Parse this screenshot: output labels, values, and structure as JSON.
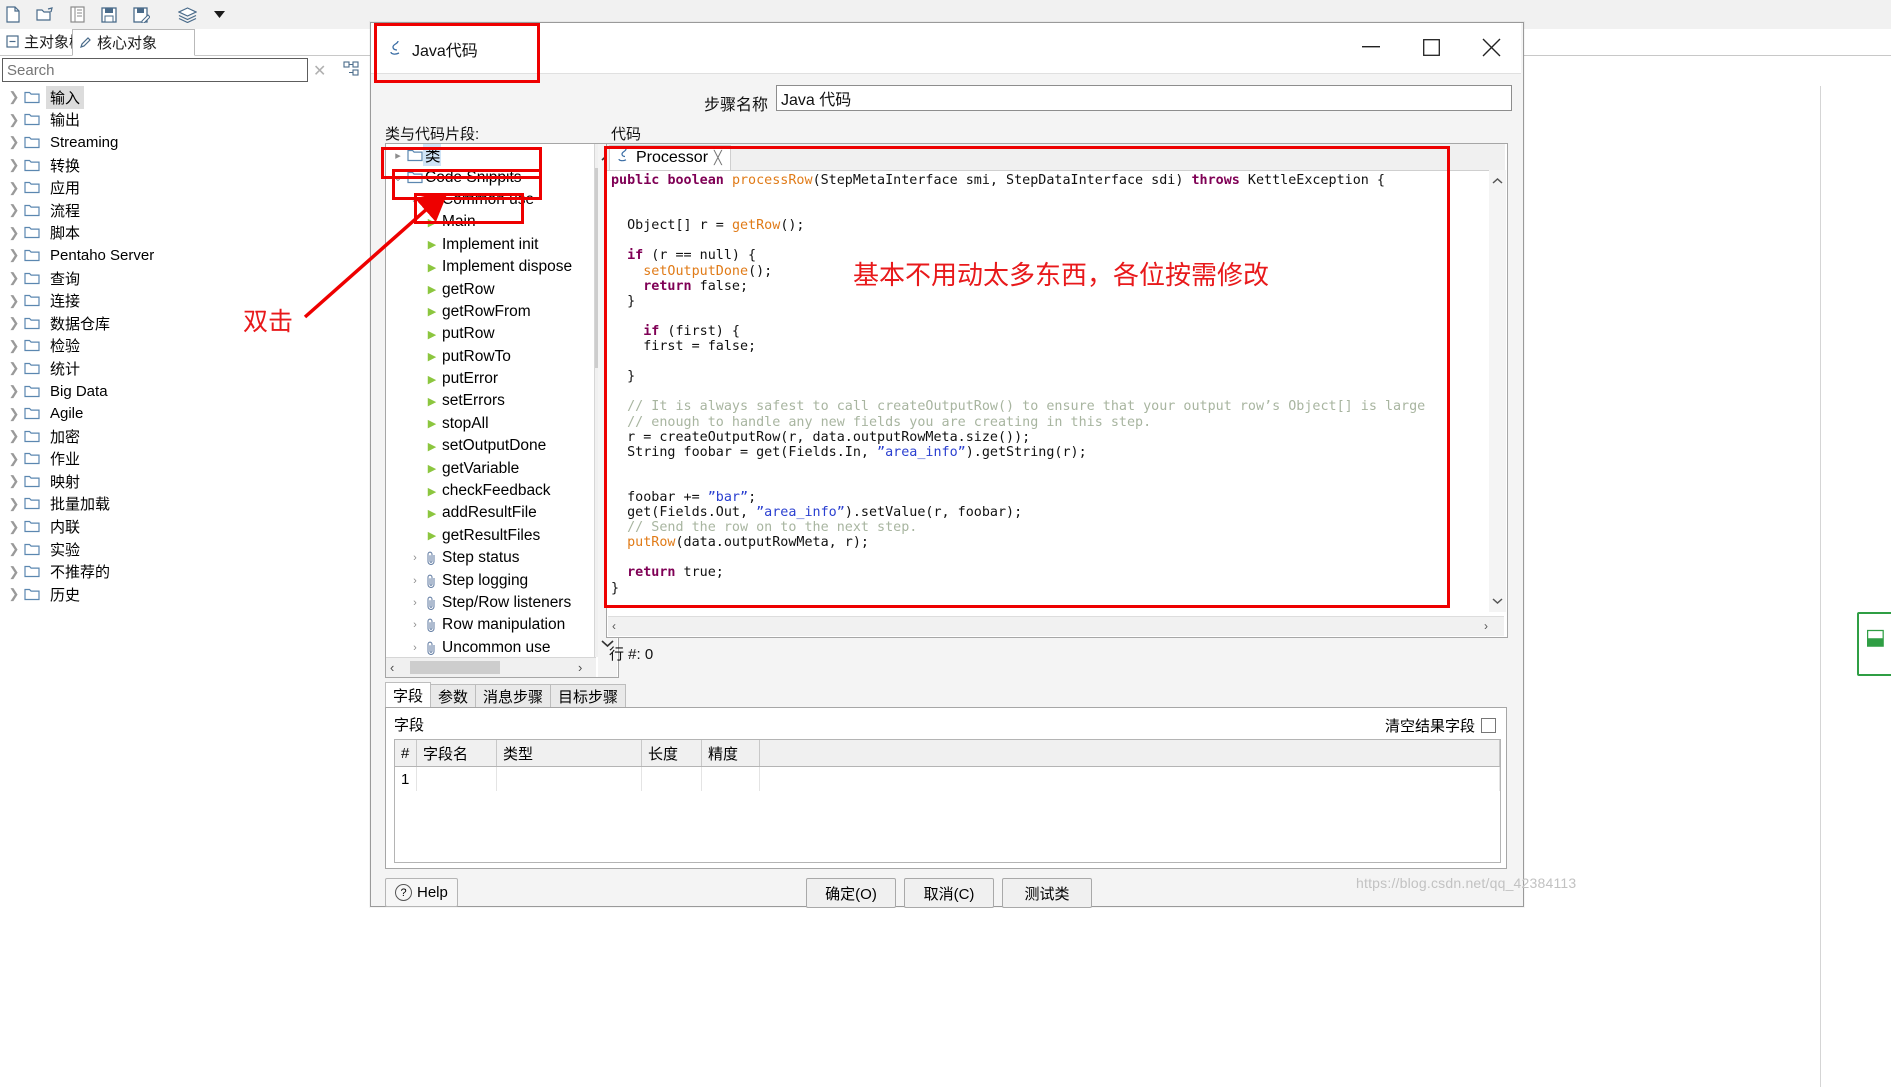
{
  "app": {
    "toolbar_icons": [
      "new-file-icon",
      "open-folder-icon",
      "explorer-icon",
      "save-icon",
      "save-as-icon",
      "layers-icon",
      "dropdown-caret-icon"
    ],
    "tabs": [
      {
        "label": "主对象树",
        "icon": "object-tree-icon",
        "selected": false
      },
      {
        "label": "核心对象",
        "icon": "pencil-icon",
        "selected": true
      }
    ],
    "search": {
      "placeholder": "Search",
      "value": ""
    },
    "tree_items": [
      {
        "label": "输入",
        "selected": true
      },
      {
        "label": "输出",
        "selected": false
      },
      {
        "label": "Streaming",
        "selected": false
      },
      {
        "label": "转换",
        "selected": false
      },
      {
        "label": "应用",
        "selected": false
      },
      {
        "label": "流程",
        "selected": false
      },
      {
        "label": "脚本",
        "selected": false
      },
      {
        "label": "Pentaho Server",
        "selected": false
      },
      {
        "label": "查询",
        "selected": false
      },
      {
        "label": "连接",
        "selected": false
      },
      {
        "label": "数据仓库",
        "selected": false
      },
      {
        "label": "检验",
        "selected": false
      },
      {
        "label": "统计",
        "selected": false
      },
      {
        "label": "Big Data",
        "selected": false
      },
      {
        "label": "Agile",
        "selected": false
      },
      {
        "label": "加密",
        "selected": false
      },
      {
        "label": "作业",
        "selected": false
      },
      {
        "label": "映射",
        "selected": false
      },
      {
        "label": "批量加载",
        "selected": false
      },
      {
        "label": "内联",
        "selected": false
      },
      {
        "label": "实验",
        "selected": false
      },
      {
        "label": "不推荐的",
        "selected": false
      },
      {
        "label": "历史",
        "selected": false
      }
    ]
  },
  "dialog": {
    "title": "Java代码",
    "title_icon": "java-step-icon",
    "window_buttons": {
      "minimize": "–",
      "maximize": "▢",
      "close": "✕"
    },
    "step_name_label": "步骤名称",
    "step_name_value": "Java 代码",
    "classes_label": "类与代码片段:",
    "code_label": "代码",
    "snippet_tree": [
      {
        "label": "类",
        "indent": 0,
        "twisty": "▸",
        "icon": "folder-icon",
        "selected": true
      },
      {
        "label": "Code Snippits",
        "indent": 0,
        "twisty": "⌄",
        "icon": "folder-icon",
        "selected": false
      },
      {
        "label": "Common use",
        "indent": 1,
        "twisty": "⌄",
        "icon": "clip-icon",
        "selected": false
      },
      {
        "label": "Main",
        "indent": 2,
        "twisty": "",
        "icon": "play-icon",
        "selected": false
      },
      {
        "label": "Implement init",
        "indent": 2,
        "twisty": "",
        "icon": "play-icon",
        "selected": false
      },
      {
        "label": "Implement dispose",
        "indent": 2,
        "twisty": "",
        "icon": "play-icon",
        "selected": false
      },
      {
        "label": "getRow",
        "indent": 2,
        "twisty": "",
        "icon": "play-icon",
        "selected": false
      },
      {
        "label": "getRowFrom",
        "indent": 2,
        "twisty": "",
        "icon": "play-icon",
        "selected": false
      },
      {
        "label": "putRow",
        "indent": 2,
        "twisty": "",
        "icon": "play-icon",
        "selected": false
      },
      {
        "label": "putRowTo",
        "indent": 2,
        "twisty": "",
        "icon": "play-icon",
        "selected": false
      },
      {
        "label": "putError",
        "indent": 2,
        "twisty": "",
        "icon": "play-icon",
        "selected": false
      },
      {
        "label": "setErrors",
        "indent": 2,
        "twisty": "",
        "icon": "play-icon",
        "selected": false
      },
      {
        "label": "stopAll",
        "indent": 2,
        "twisty": "",
        "icon": "play-icon",
        "selected": false
      },
      {
        "label": "setOutputDone",
        "indent": 2,
        "twisty": "",
        "icon": "play-icon",
        "selected": false
      },
      {
        "label": "getVariable",
        "indent": 2,
        "twisty": "",
        "icon": "play-icon",
        "selected": false
      },
      {
        "label": "checkFeedback",
        "indent": 2,
        "twisty": "",
        "icon": "play-icon",
        "selected": false
      },
      {
        "label": "addResultFile",
        "indent": 2,
        "twisty": "",
        "icon": "play-icon",
        "selected": false
      },
      {
        "label": "getResultFiles",
        "indent": 2,
        "twisty": "",
        "icon": "play-icon",
        "selected": false
      },
      {
        "label": "Step status",
        "indent": 1,
        "twisty": "›",
        "icon": "clip-icon",
        "selected": false
      },
      {
        "label": "Step logging",
        "indent": 1,
        "twisty": "›",
        "icon": "clip-icon",
        "selected": false
      },
      {
        "label": "Step/Row listeners",
        "indent": 1,
        "twisty": "›",
        "icon": "clip-icon",
        "selected": false
      },
      {
        "label": "Row manipulation",
        "indent": 1,
        "twisty": "›",
        "icon": "clip-icon",
        "selected": false
      },
      {
        "label": "Uncommon use",
        "indent": 1,
        "twisty": "›",
        "icon": "clip-icon",
        "selected": false
      }
    ],
    "code_tab": {
      "label": "Processor",
      "icon": "java-class-icon",
      "close": "✕"
    },
    "line_status": "行 #: 0",
    "annotations": {
      "code_note": "基本不用动太多东西，各位按需修改",
      "double_click": "双击",
      "accent_color": "#ee0000"
    },
    "bottom_tabs": [
      {
        "label": "字段",
        "selected": true
      },
      {
        "label": "参数",
        "selected": false
      },
      {
        "label": "消息步骤",
        "selected": false
      },
      {
        "label": "目标步骤",
        "selected": false
      }
    ],
    "fields": {
      "title": "字段",
      "clear_checkbox_label": "清空结果字段",
      "clear_checkbox_checked": false,
      "columns": [
        "#",
        "字段名",
        "类型",
        "长度",
        "精度",
        ""
      ],
      "rows": [
        [
          "1",
          "",
          "",
          "",
          "",
          ""
        ]
      ]
    },
    "footer": {
      "help": "Help",
      "ok": "确定(O)",
      "cancel": "取消(C)",
      "test": "测试类"
    }
  },
  "watermark": "https://blog.csdn.net/qq_42384113"
}
